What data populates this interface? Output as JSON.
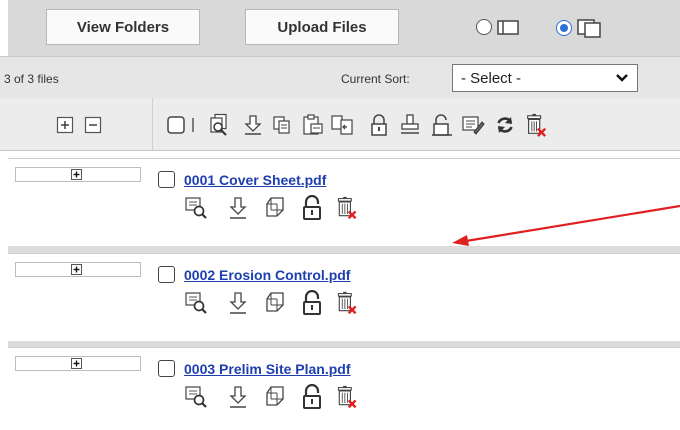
{
  "toolbar": {
    "view_folders_label": "View Folders",
    "upload_files_label": "Upload Files",
    "view_options": [
      {
        "icon": "list-view-icon",
        "selected": false
      },
      {
        "icon": "grid-view-icon",
        "selected": true
      }
    ]
  },
  "sort_bar": {
    "file_count": "3 of 3 files",
    "sort_label": "Current Sort:",
    "sort_value": "- Select -"
  },
  "action_bar": {
    "left_icons": [
      "expand-all-icon",
      "collapse-all-icon"
    ],
    "icons": [
      "select-all-checkbox",
      "separator",
      "search-document-icon",
      "download-icon",
      "copy-icon",
      "move-icon",
      "merge-icon",
      "lock-icon",
      "stamp-icon",
      "unlock-icon",
      "edit-icon",
      "refresh-icon",
      "delete-icon"
    ]
  },
  "files": [
    {
      "name": "0001 Cover Sheet.pdf"
    },
    {
      "name": "0002 Erosion Control.pdf"
    },
    {
      "name": "0003 Prelim Site Plan.pdf"
    }
  ],
  "row_actions": [
    "view-icon",
    "download-icon",
    "copy-icon",
    "unlock-icon",
    "delete-icon"
  ],
  "colors": {
    "link": "#1e3fb0",
    "radio_selected": "#2f6fd6",
    "delete_x": "#e02020",
    "annotation_arrow": "#e02020"
  }
}
